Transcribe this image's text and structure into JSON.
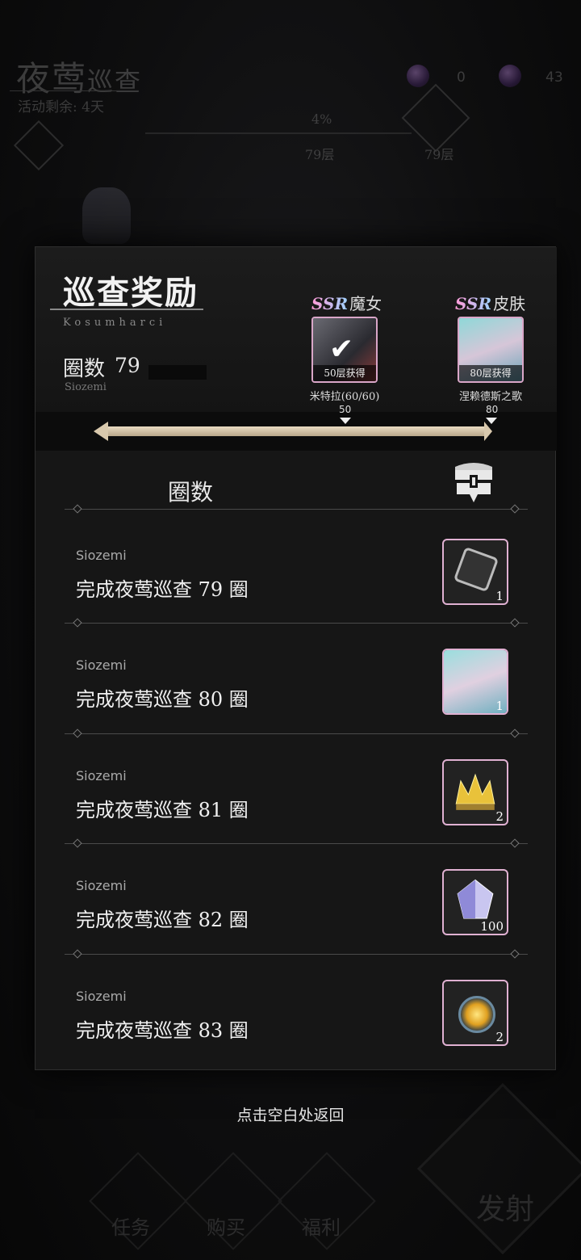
{
  "header": {
    "title_main": "夜莺",
    "title_sub": "巡查",
    "remaining": "活动剩余: 4天",
    "currency_1": "0",
    "currency_2": "43",
    "progress_percent": "4%",
    "progress_fraction": 0.04,
    "level_left": "79层",
    "level_right": "79层"
  },
  "panel": {
    "title": "巡查奖励",
    "subtitle": "Kosumharci",
    "count_label": "圈数",
    "count_value": "79",
    "count_sub": "Siozemi",
    "featured": [
      {
        "rarity": "SSR",
        "type": "魔女",
        "tag": "50层获得",
        "name": "米特拉(60/60)",
        "claimed": true,
        "marker": "50"
      },
      {
        "rarity": "SSR",
        "type": "皮肤",
        "tag": "80层获得",
        "name": "涅赖德斯之歌",
        "claimed": false,
        "marker": "80"
      }
    ],
    "column_header": "圈数",
    "rows": [
      {
        "sub": "Siozemi",
        "text": "完成夜莺巡查 79 圈",
        "icon": "dice-icon",
        "qty": "1"
      },
      {
        "sub": "Siozemi",
        "text": "完成夜莺巡查 80 圈",
        "icon": "skin-portrait-icon",
        "qty": "1"
      },
      {
        "sub": "Siozemi",
        "text": "完成夜莺巡查 81 圈",
        "icon": "crown-icon",
        "qty": "2"
      },
      {
        "sub": "Siozemi",
        "text": "完成夜莺巡查 82 圈",
        "icon": "crystal-icon",
        "qty": "100"
      },
      {
        "sub": "Siozemi",
        "text": "完成夜莺巡查 83 圈",
        "icon": "golden-orb-icon",
        "qty": "2"
      }
    ]
  },
  "back_hint": "点击空白处返回",
  "bottom_nav": [
    {
      "label": "任务"
    },
    {
      "label": "购买"
    },
    {
      "label": "福利"
    }
  ],
  "fire_label": "发射",
  "colors": {
    "accent_pink": "#e0b1d2",
    "track_gold": "#d9c9ad"
  }
}
